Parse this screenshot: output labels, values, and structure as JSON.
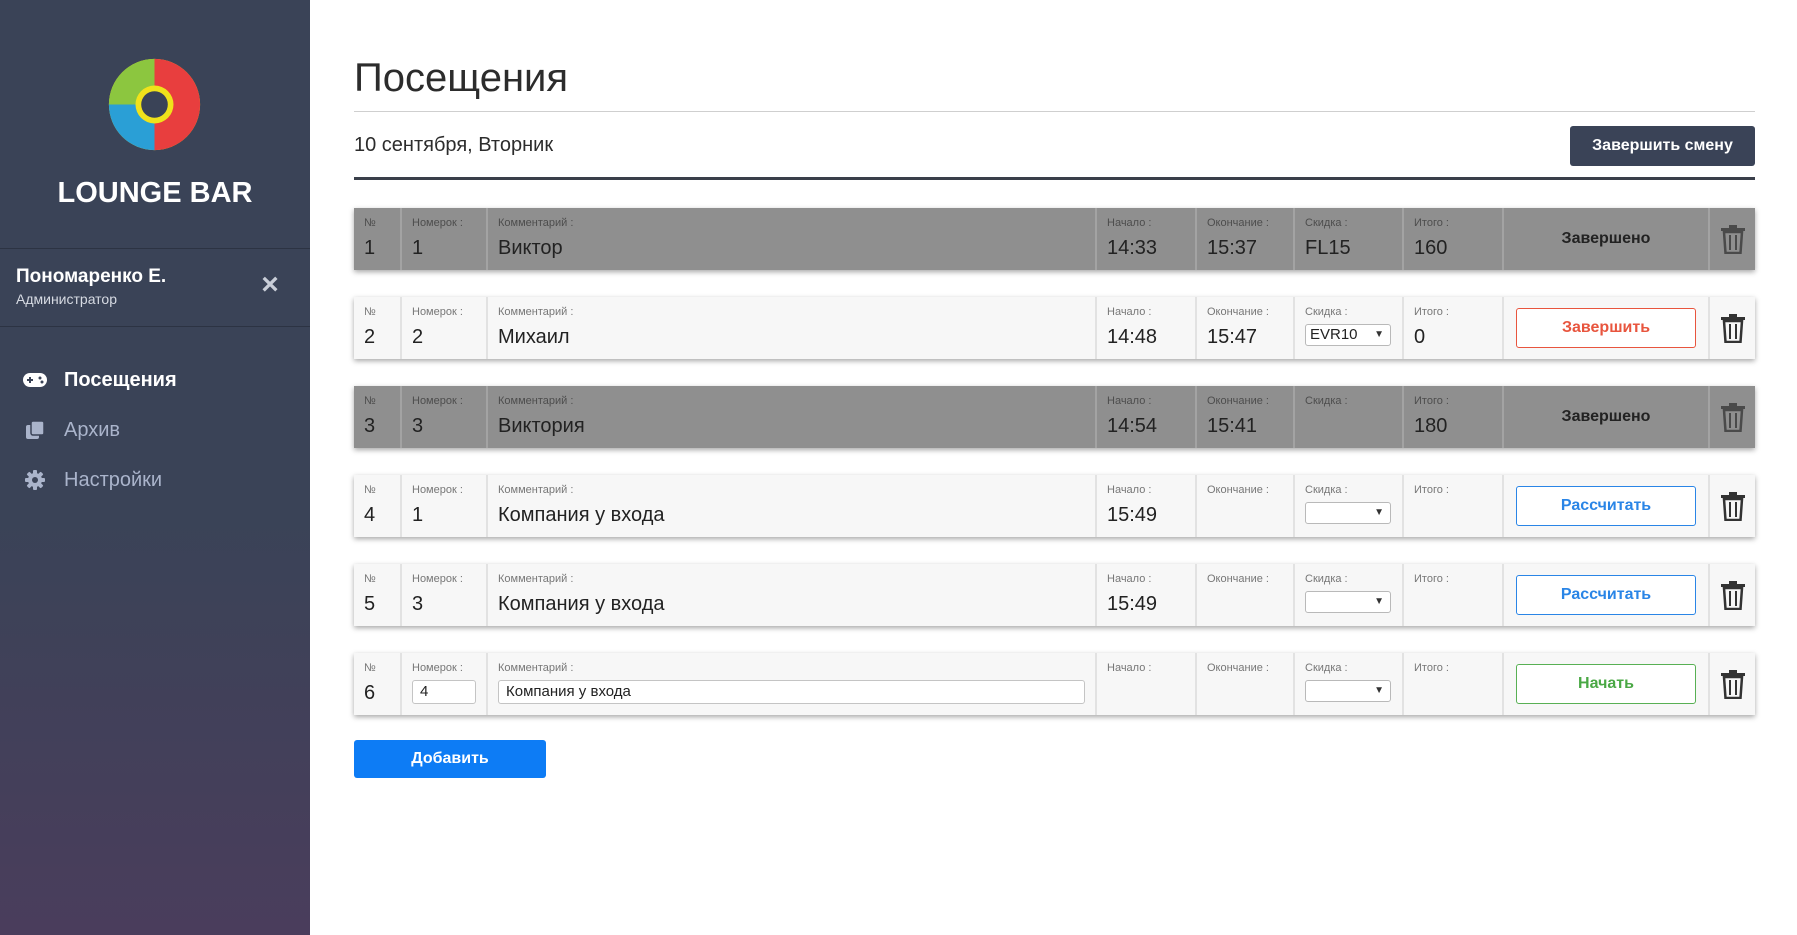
{
  "sidebar": {
    "brand": "LOUNGE BAR",
    "user": {
      "name": "Пономаренко Е.",
      "role": "Администратор"
    },
    "nav": [
      {
        "label": "Посещения",
        "icon": "gamepad-icon",
        "active": true
      },
      {
        "label": "Архив",
        "icon": "copy-icon",
        "active": false
      },
      {
        "label": "Настройки",
        "icon": "gear-icon",
        "active": false
      }
    ]
  },
  "main": {
    "title": "Посещения",
    "date": "10 сентября, Вторник",
    "end_shift_label": "Завершить смену",
    "add_label": "Добавить"
  },
  "labels": {
    "no": "№",
    "num": "Номерок :",
    "comment": "Комментарий :",
    "start": "Начало :",
    "end": "Окончание :",
    "discount": "Скидка :",
    "total": "Итого :"
  },
  "visits": [
    {
      "no": "1",
      "num": "1",
      "comment": "Виктор",
      "start": "14:33",
      "end": "15:37",
      "discount": "FL15",
      "total": "160",
      "status": "Завершено"
    },
    {
      "no": "2",
      "num": "2",
      "comment": "Михаил",
      "start": "14:48",
      "end": "15:47",
      "discount": "EVR10",
      "total": "0",
      "action": "Завершить"
    },
    {
      "no": "3",
      "num": "3",
      "comment": "Виктория",
      "start": "14:54",
      "end": "15:41",
      "discount": "",
      "total": "180",
      "status": "Завершено"
    },
    {
      "no": "4",
      "num": "1",
      "comment": "Компания у входа",
      "start": "15:49",
      "end": "",
      "discount": "",
      "total": "",
      "action": "Рассчитать"
    },
    {
      "no": "5",
      "num": "3",
      "comment": "Компания у входа",
      "start": "15:49",
      "end": "",
      "discount": "",
      "total": "",
      "action": "Рассчитать"
    },
    {
      "no": "6",
      "num": "4",
      "comment": "Компания у входа",
      "start": "",
      "end": "",
      "discount": "",
      "total": "",
      "action": "Начать"
    }
  ],
  "colors": {
    "sidebar_bg": "#3a4357",
    "done_row_bg": "#8f8f8f",
    "finish": "#e8553e",
    "calc": "#2a85e6",
    "start": "#4aa845",
    "add_btn": "#0d7cf5"
  }
}
